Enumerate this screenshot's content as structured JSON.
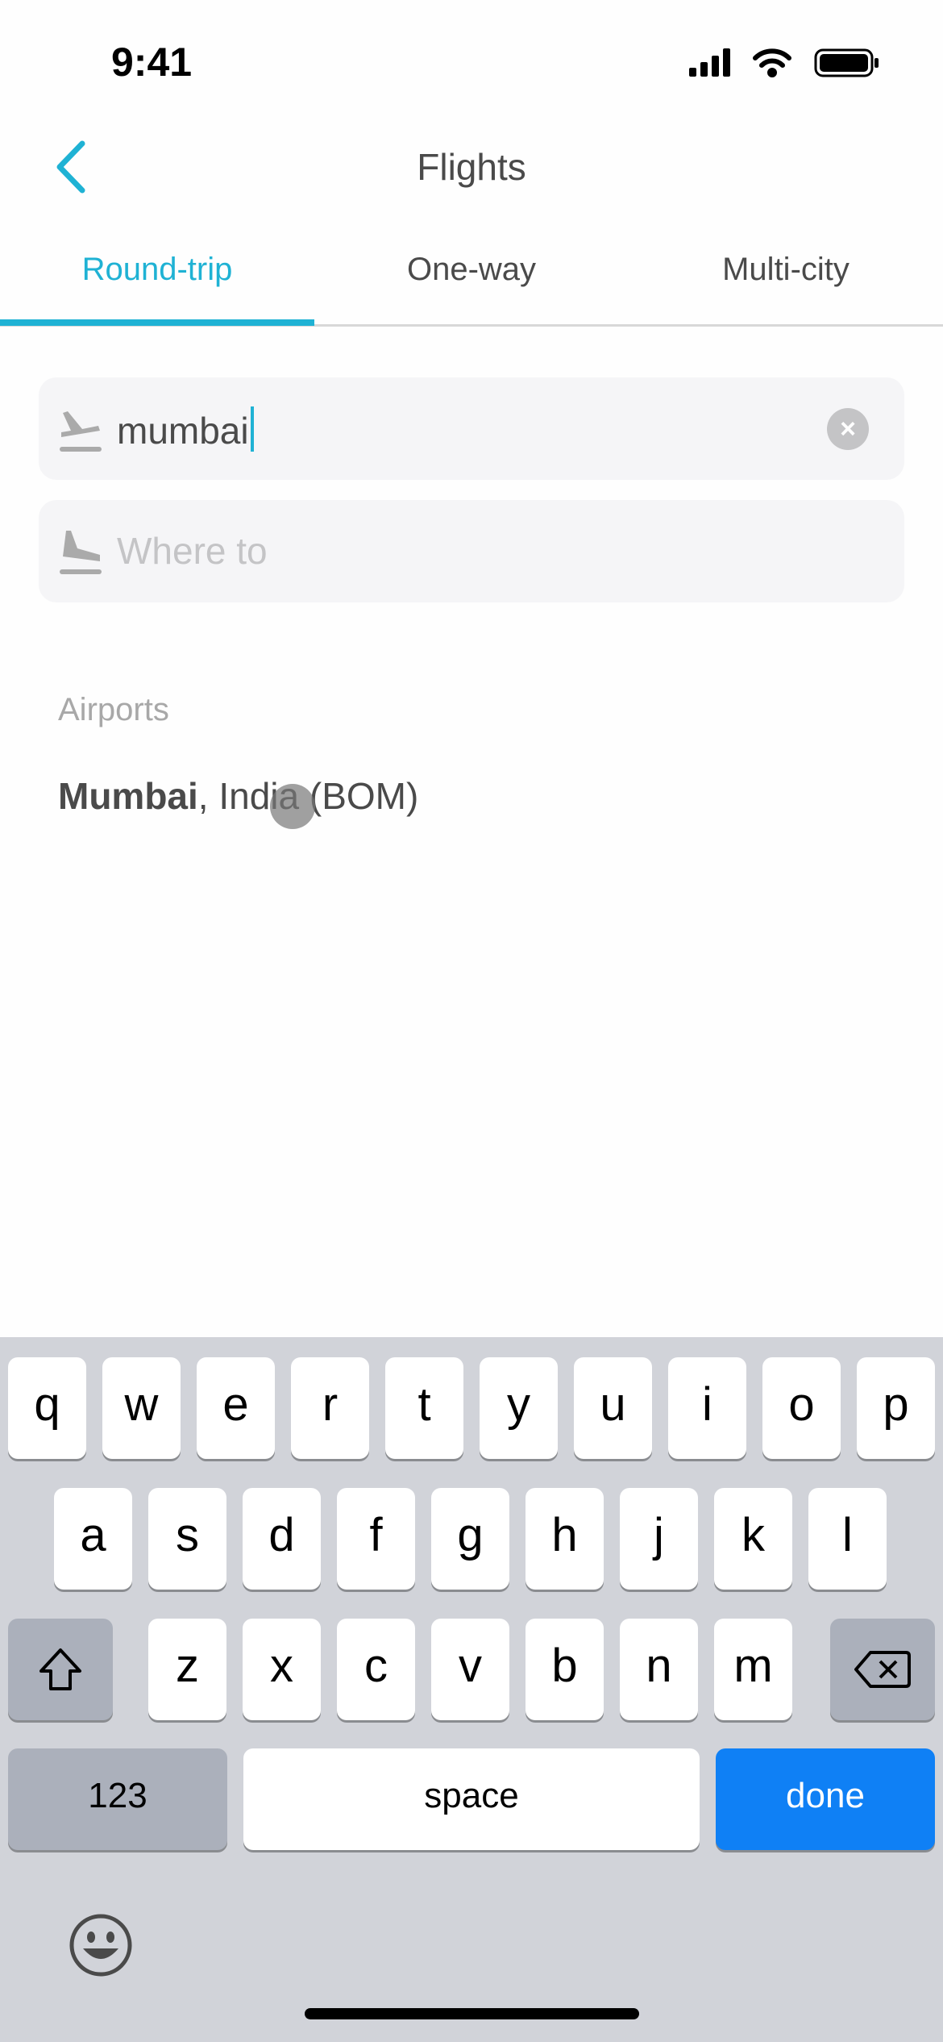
{
  "status_bar": {
    "time": "9:41"
  },
  "header": {
    "title": "Flights",
    "back_icon": "chevron-left-icon"
  },
  "tabs": [
    {
      "label": "Round-trip",
      "active": true
    },
    {
      "label": "One-way",
      "active": false
    },
    {
      "label": "Multi-city",
      "active": false
    }
  ],
  "search": {
    "from_value": "mumbai",
    "to_placeholder": "Where to"
  },
  "results": {
    "section_label": "Airports",
    "items": [
      {
        "city": "Mumbai",
        "rest": ", India (BOM)"
      }
    ]
  },
  "keyboard": {
    "row1": [
      "q",
      "w",
      "e",
      "r",
      "t",
      "y",
      "u",
      "i",
      "o",
      "p"
    ],
    "row2": [
      "a",
      "s",
      "d",
      "f",
      "g",
      "h",
      "j",
      "k",
      "l"
    ],
    "row3": [
      "z",
      "x",
      "c",
      "v",
      "b",
      "n",
      "m"
    ],
    "numbers_label": "123",
    "space_label": "space",
    "done_label": "done"
  },
  "colors": {
    "accent": "#1fb2d4",
    "done": "#0f80f5"
  }
}
